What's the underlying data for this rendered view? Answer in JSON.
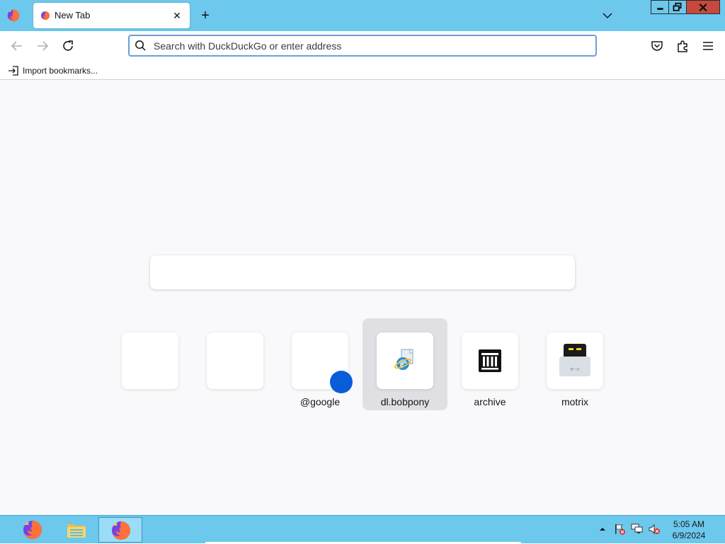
{
  "tab": {
    "title": "New Tab",
    "close_glyph": "✕"
  },
  "tabstrip": {
    "new_tab_glyph": "+",
    "menu_icon": "firefox-icon",
    "list_tabs_icon": "chevron-down-icon"
  },
  "window_controls": {
    "minimize_icon": "minimize-icon",
    "restore_icon": "restore-icon",
    "close_icon": "close-icon"
  },
  "urlbar": {
    "placeholder": "Search with DuckDuckGo or enter address",
    "value": "",
    "icon": "search-icon"
  },
  "toolbar": {
    "back_icon": "arrow-left-icon",
    "forward_icon": "arrow-right-icon",
    "reload_icon": "reload-icon",
    "pocket_icon": "pocket-icon",
    "extensions_icon": "puzzle-icon",
    "menu_icon": "hamburger-icon"
  },
  "bookmarks": {
    "import_label": "Import bookmarks..."
  },
  "shortcuts": [
    {
      "label": "",
      "icon": ""
    },
    {
      "label": "",
      "icon": ""
    },
    {
      "label": "@google",
      "icon": "blue-dot"
    },
    {
      "label": "dl.bobpony",
      "icon": "internet-explorer-icon"
    },
    {
      "label": "archive",
      "icon": "archive-building-icon"
    },
    {
      "label": "motrix",
      "icon": "motrix-icon"
    }
  ],
  "taskbar": {
    "items": [
      {
        "name": "firefox",
        "icon": "firefox-icon"
      },
      {
        "name": "file-explorer",
        "icon": "folder-icon"
      },
      {
        "name": "firefox-active",
        "icon": "firefox-icon"
      }
    ],
    "time": "5:05 AM",
    "date": "6/9/2024",
    "tray_icons": [
      "action-center-flag-icon",
      "network-icon",
      "volume-muted-icon"
    ]
  },
  "colors": {
    "tabstrip_bg": "#6cc8ec",
    "urlbar_border": "#6a9fd8",
    "pin_dot": "#0a5dd8",
    "close_button": "#c7493d"
  }
}
